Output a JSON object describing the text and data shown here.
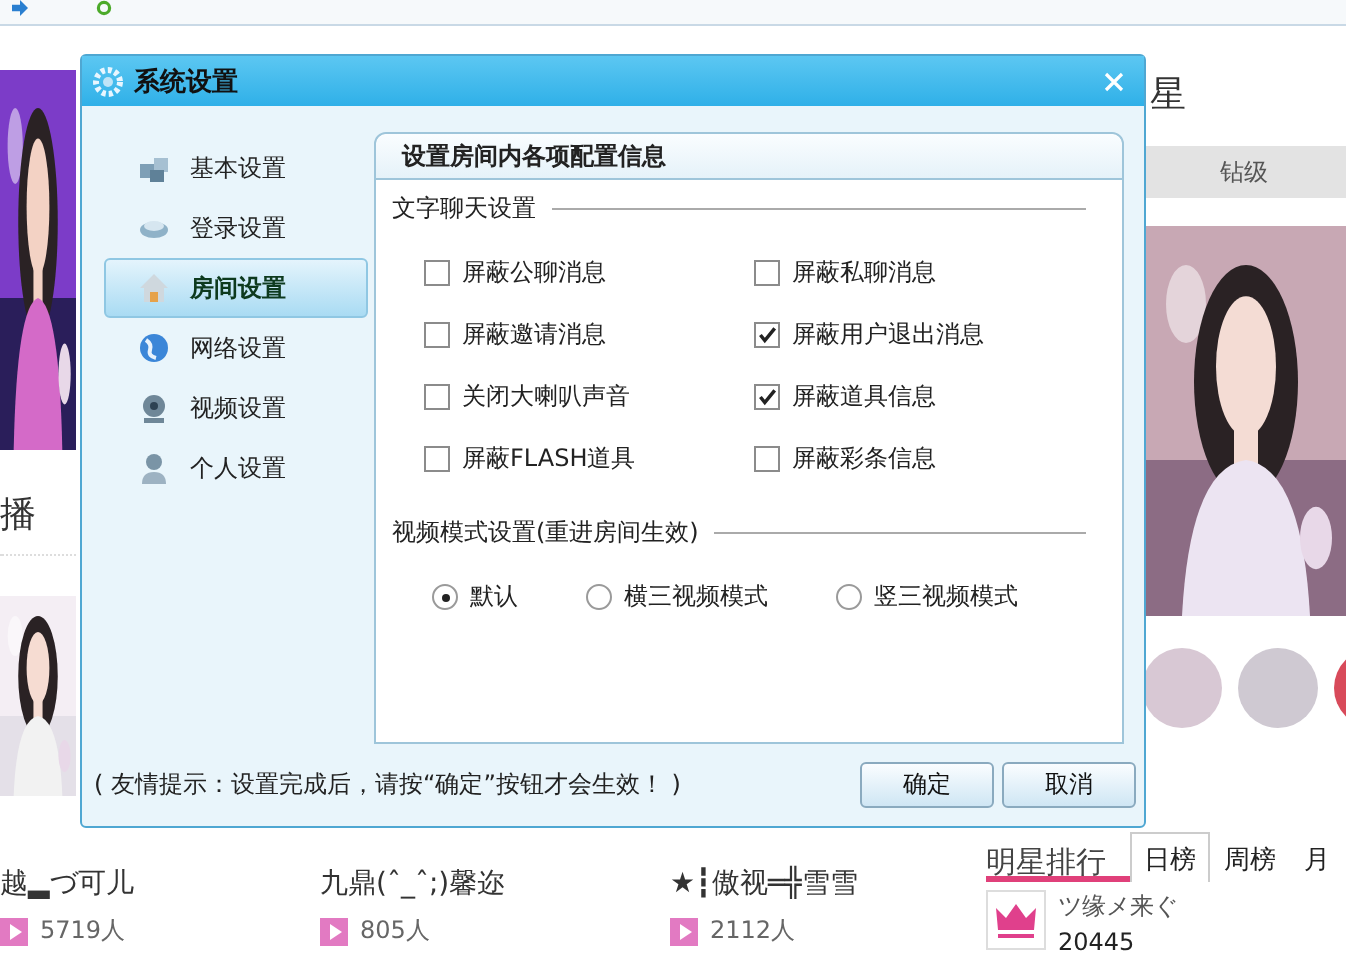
{
  "page": {
    "left_heading": "播",
    "right_heading": "星",
    "right_tab": "钻级",
    "streams": [
      {
        "name": "越▂づ可儿",
        "viewers": "5719人"
      },
      {
        "name": "九鼎(ˆ_ˆ;)馨迩",
        "viewers": "805人"
      },
      {
        "name": "★┇傲视═╬雪雪",
        "viewers": "2112人"
      }
    ],
    "ranking": {
      "title": "明星排行",
      "tabs": [
        {
          "label": "日榜",
          "selected": true
        },
        {
          "label": "周榜",
          "selected": false
        },
        {
          "label": "月",
          "selected": false
        }
      ],
      "top": {
        "name": "ツ缘メ来ぐ",
        "score": "20445"
      }
    }
  },
  "dialog": {
    "title": "系统设置",
    "nav": [
      {
        "label": "基本设置",
        "selected": false,
        "kind": "basic"
      },
      {
        "label": "登录设置",
        "selected": false,
        "kind": "login"
      },
      {
        "label": "房间设置",
        "selected": true,
        "kind": "room"
      },
      {
        "label": "网络设置",
        "selected": false,
        "kind": "network"
      },
      {
        "label": "视频设置",
        "selected": false,
        "kind": "video"
      },
      {
        "label": "个人设置",
        "selected": false,
        "kind": "personal"
      }
    ],
    "panel_title": "设置房间内各项配置信息",
    "sections": [
      {
        "title": "文字聊天设置",
        "kind": "checkboxes",
        "items": [
          {
            "label": "屏蔽公聊消息",
            "checked": false
          },
          {
            "label": "屏蔽私聊消息",
            "checked": false
          },
          {
            "label": "屏蔽邀请消息",
            "checked": false
          },
          {
            "label": "屏蔽用户退出消息",
            "checked": true
          },
          {
            "label": "关闭大喇叭声音",
            "checked": false
          },
          {
            "label": "屏蔽道具信息",
            "checked": true
          },
          {
            "label": "屏蔽FLASH道具",
            "checked": false
          },
          {
            "label": "屏蔽彩条信息",
            "checked": false
          }
        ]
      },
      {
        "title": "视频模式设置(重进房间生效)",
        "kind": "radios",
        "items": [
          {
            "label": "默认",
            "selected": true
          },
          {
            "label": "横三视频模式",
            "selected": false
          },
          {
            "label": "竖三视频模式",
            "selected": false
          }
        ]
      }
    ],
    "tip": "( 友情提示：设置完成后，请按“确定”按钮才会生效！ )",
    "buttons": [
      "确定",
      "取消"
    ]
  }
}
